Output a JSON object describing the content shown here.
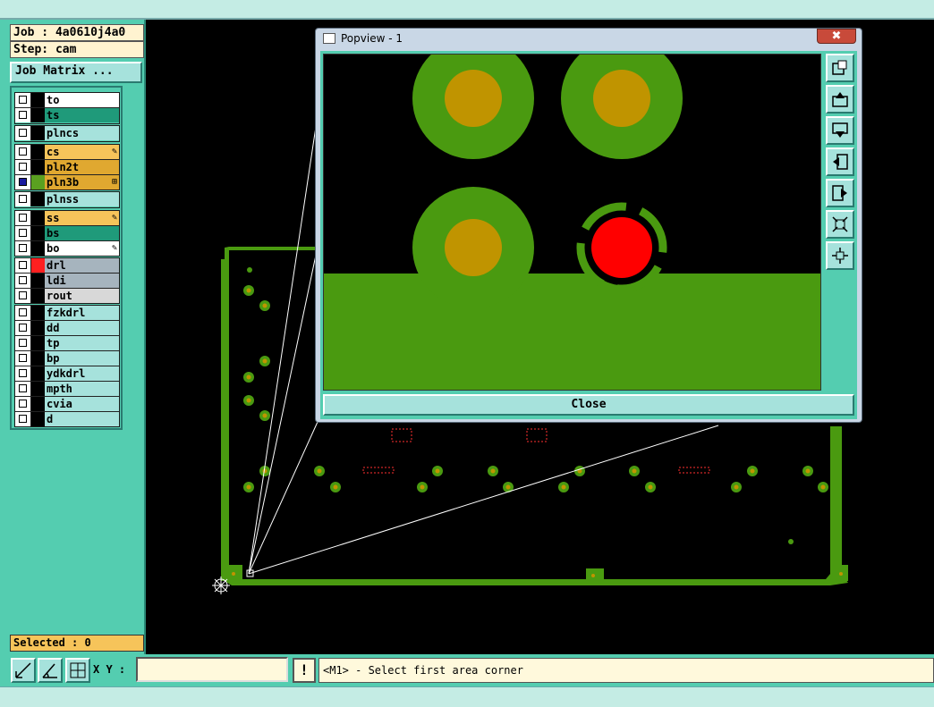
{
  "job": {
    "label": "Job : 4a0610j4a0",
    "step": "Step: cam",
    "matrix_button": "Job Matrix ..."
  },
  "layers": [
    {
      "name": "to",
      "color": "#ffffff",
      "swatch": "#000000",
      "checked": false,
      "mark": ""
    },
    {
      "name": "ts",
      "color": "#1f9a7a",
      "swatch": "#000000",
      "checked": false,
      "mark": ""
    },
    {
      "name": "plncs",
      "color": "#a6e2dc",
      "swatch": "#000000",
      "checked": false,
      "mark": ""
    },
    {
      "name": "cs",
      "color": "#f6c45a",
      "swatch": "#000000",
      "checked": false,
      "mark": "✎"
    },
    {
      "name": "pln2t",
      "color": "#e0a830",
      "swatch": "#000000",
      "checked": false,
      "mark": ""
    },
    {
      "name": "pln3b",
      "color": "#e0a830",
      "swatch": "#5aa020",
      "checked": true,
      "mark": "⊞"
    },
    {
      "name": "plnss",
      "color": "#a6e2dc",
      "swatch": "#000000",
      "checked": false,
      "mark": ""
    },
    {
      "name": "ss",
      "color": "#f6c45a",
      "swatch": "#000000",
      "checked": false,
      "mark": "✎"
    },
    {
      "name": "bs",
      "color": "#1f9a7a",
      "swatch": "#000000",
      "checked": false,
      "mark": ""
    },
    {
      "name": "bo",
      "color": "#ffffff",
      "swatch": "#000000",
      "checked": false,
      "mark": "✎"
    },
    {
      "name": "drl",
      "color": "#a6b4be",
      "swatch": "#ff2020",
      "checked": false,
      "mark": ""
    },
    {
      "name": "ldi",
      "color": "#a6b4be",
      "swatch": "#000000",
      "checked": false,
      "mark": ""
    },
    {
      "name": "rout",
      "color": "#d8d8d8",
      "swatch": "#000000",
      "checked": false,
      "mark": ""
    },
    {
      "name": "fzkdrl",
      "color": "#a6e2dc",
      "swatch": "#000000",
      "checked": false,
      "mark": ""
    },
    {
      "name": "dd",
      "color": "#a6e2dc",
      "swatch": "#000000",
      "checked": false,
      "mark": ""
    },
    {
      "name": "tp",
      "color": "#a6e2dc",
      "swatch": "#000000",
      "checked": false,
      "mark": ""
    },
    {
      "name": "bp",
      "color": "#a6e2dc",
      "swatch": "#000000",
      "checked": false,
      "mark": ""
    },
    {
      "name": "ydkdrl",
      "color": "#a6e2dc",
      "swatch": "#000000",
      "checked": false,
      "mark": ""
    },
    {
      "name": "mpth",
      "color": "#a6e2dc",
      "swatch": "#000000",
      "checked": false,
      "mark": ""
    },
    {
      "name": "cvia",
      "color": "#a6e2dc",
      "swatch": "#000000",
      "checked": false,
      "mark": ""
    },
    {
      "name": "d",
      "color": "#a6e2dc",
      "swatch": "#000000",
      "checked": false,
      "mark": ""
    }
  ],
  "selected": "Selected : 0",
  "popview": {
    "title": "Popview - 1",
    "close_x": "✖",
    "close_button": "Close"
  },
  "coords": {
    "label": "X Y :",
    "value": "",
    "bang": "!"
  },
  "message": "<M1> - Select first area corner",
  "colors": {
    "panel": "#54cdb0",
    "copper": "#4a9a10",
    "pad": "#c09400",
    "drill": "#ff0000"
  }
}
